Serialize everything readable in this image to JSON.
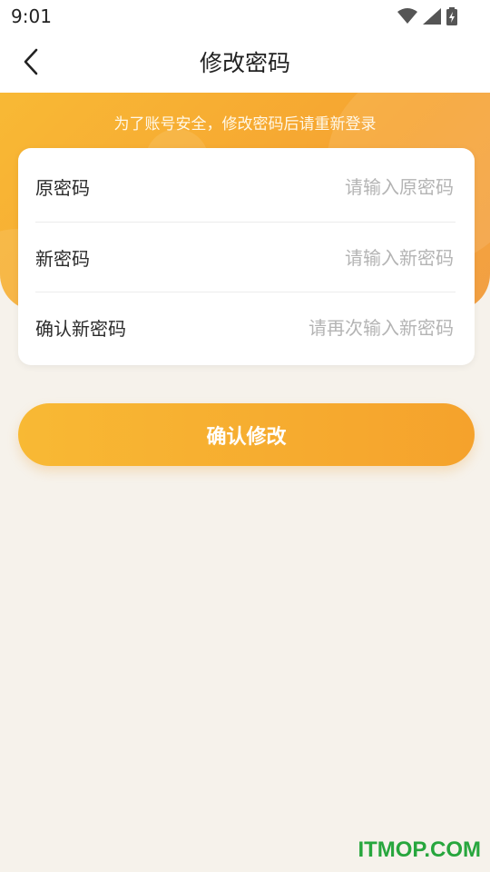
{
  "status_bar": {
    "time": "9:01",
    "icons": [
      "wifi-icon",
      "signal-icon",
      "battery-icon"
    ]
  },
  "app_bar": {
    "title": "修改密码",
    "back_icon": "chevron-left-icon"
  },
  "hero": {
    "note": "为了账号安全，修改密码后请重新登录"
  },
  "form": {
    "fields": [
      {
        "label": "原密码",
        "placeholder": "请输入原密码"
      },
      {
        "label": "新密码",
        "placeholder": "请输入新密码"
      },
      {
        "label": "确认新密码",
        "placeholder": "请再次输入新密码"
      }
    ]
  },
  "submit": {
    "label": "确认修改"
  },
  "watermark": "ITMOP.COM",
  "colors": {
    "accent": "#f6a431",
    "accent_light": "#f8b935",
    "background": "#f6f2eb"
  }
}
